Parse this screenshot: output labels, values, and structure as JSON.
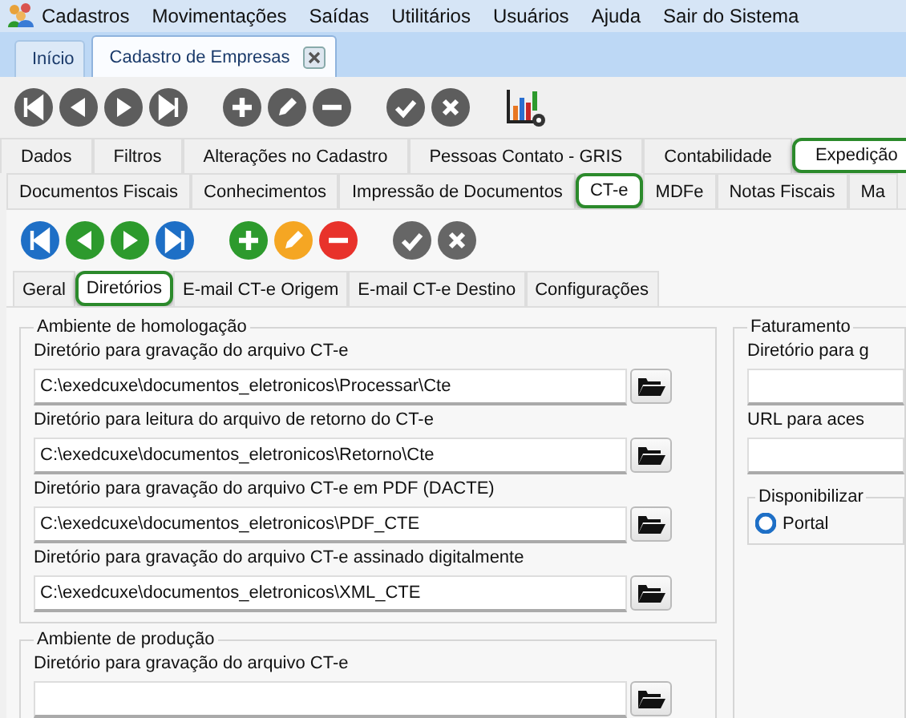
{
  "menu": [
    "Cadastros",
    "Movimentações",
    "Saídas",
    "Utilitários",
    "Usuários",
    "Ajuda",
    "Sair do Sistema"
  ],
  "doc_tabs": [
    {
      "label": "Início",
      "selected": false,
      "closable": false
    },
    {
      "label": "Cadastro de Empresas",
      "selected": true,
      "closable": true
    }
  ],
  "tabs_main": [
    {
      "label": "Dados",
      "selected": false
    },
    {
      "label": "Filtros",
      "selected": false
    },
    {
      "label": "Alterações no Cadastro",
      "selected": false
    },
    {
      "label": "Pessoas Contato - GRIS",
      "selected": false
    },
    {
      "label": "Contabilidade",
      "selected": false
    },
    {
      "label": "Expedição",
      "selected": true
    }
  ],
  "tabs_expedicao": [
    {
      "label": "Documentos Fiscais",
      "selected": false
    },
    {
      "label": "Conhecimentos",
      "selected": false
    },
    {
      "label": "Impressão de Documentos",
      "selected": false
    },
    {
      "label": "CT-e",
      "selected": true
    },
    {
      "label": "MDFe",
      "selected": false
    },
    {
      "label": "Notas Fiscais",
      "selected": false
    },
    {
      "label": "Ma",
      "selected": false
    }
  ],
  "tabs_cte": [
    {
      "label": "Geral",
      "selected": false
    },
    {
      "label": "Diretórios",
      "selected": true
    },
    {
      "label": "E-mail CT-e Origem",
      "selected": false
    },
    {
      "label": "E-mail CT-e Destino",
      "selected": false
    },
    {
      "label": "Configurações",
      "selected": false
    }
  ],
  "homologacao": {
    "title": "Ambiente de homologação",
    "fields": [
      {
        "label": "Diretório para gravação do arquivo CT-e",
        "value": "C:\\exedcuxe\\documentos_eletronicos\\Processar\\Cte"
      },
      {
        "label": "Diretório para leitura do arquivo de retorno do CT-e",
        "value": "C:\\exedcuxe\\documentos_eletronicos\\Retorno\\Cte"
      },
      {
        "label": "Diretório para gravação do arquivo CT-e em PDF (DACTE)",
        "value": "C:\\exedcuxe\\documentos_eletronicos\\PDF_CTE"
      },
      {
        "label": "Diretório para gravação do arquivo CT-e assinado digitalmente",
        "value": "C:\\exedcuxe\\documentos_eletronicos\\XML_CTE"
      }
    ]
  },
  "producao": {
    "title": "Ambiente de produção",
    "fields": [
      {
        "label": "Diretório para gravação do arquivo CT-e"
      }
    ]
  },
  "faturamento": {
    "title": "Faturamento",
    "fields": [
      {
        "label": "Diretório para g"
      },
      {
        "label": "URL para aces"
      }
    ],
    "group": {
      "title": "Disponibilizar",
      "options": [
        {
          "label": "Portal",
          "selected": true
        }
      ]
    }
  }
}
